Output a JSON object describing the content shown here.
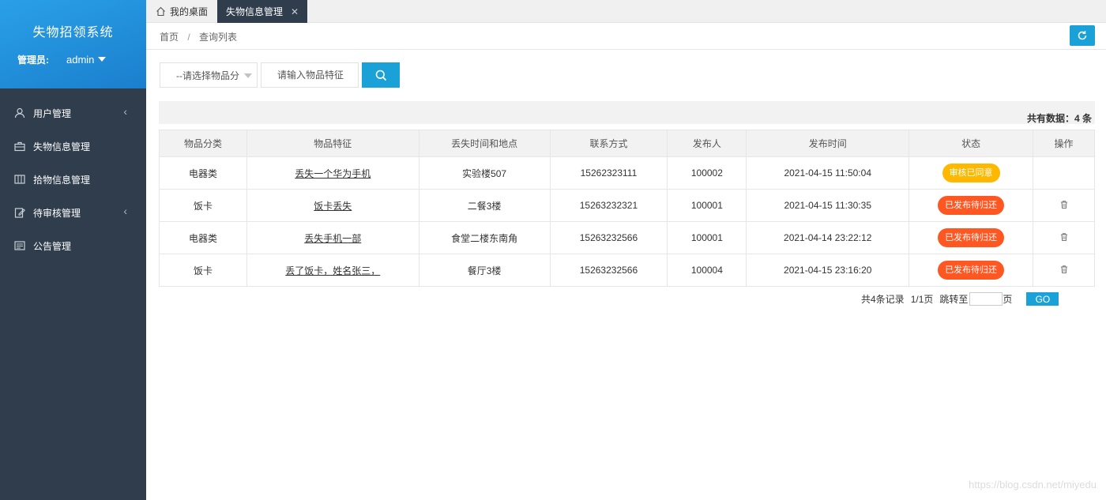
{
  "sidebar": {
    "title": "失物招领系统",
    "admin_label": "管理员:",
    "admin_name": "admin",
    "items": [
      {
        "label": "用户管理",
        "icon": "user-icon",
        "has_chevron": true
      },
      {
        "label": "失物信息管理",
        "icon": "briefcase-icon",
        "has_chevron": false
      },
      {
        "label": "拾物信息管理",
        "icon": "columns-icon",
        "has_chevron": false
      },
      {
        "label": "待审核管理",
        "icon": "edit-icon",
        "has_chevron": true
      },
      {
        "label": "公告管理",
        "icon": "notice-icon",
        "has_chevron": false
      }
    ]
  },
  "tabs": {
    "home_label": "我的桌面",
    "active_label": "失物信息管理",
    "close_glyph": "✕"
  },
  "breadcrumb": {
    "home": "首页",
    "separator": "/",
    "current": "查询列表"
  },
  "search": {
    "select_value": "--请选择物品分",
    "input_placeholder": "请输入物品特征"
  },
  "total": "共有数据：4 条",
  "table": {
    "headers": [
      "物品分类",
      "物品特征",
      "丢失时间和地点",
      "联系方式",
      "发布人",
      "发布时间",
      "状态",
      "操作"
    ],
    "rows": [
      {
        "category": "电器类",
        "feature": "丢失一个华为手机",
        "place": "实验楼507",
        "phone": "15262323111",
        "publisher": "100002",
        "time": "2021-04-15 11:50:04",
        "status": "审核已同意",
        "status_color": "#ffb800",
        "has_delete": false
      },
      {
        "category": "饭卡",
        "feature": "饭卡丢失",
        "place": "二餐3楼",
        "phone": "15263232321",
        "publisher": "100001",
        "time": "2021-04-15 11:30:35",
        "status": "已发布待归还",
        "status_color": "#ff5722",
        "has_delete": true
      },
      {
        "category": "电器类",
        "feature": "丢失手机一部",
        "place": "食堂二楼东南角",
        "phone": "15263232566",
        "publisher": "100001",
        "time": "2021-04-14 23:22:12",
        "status": "已发布待归还",
        "status_color": "#ff5722",
        "has_delete": true
      },
      {
        "category": "饭卡",
        "feature": "丢了饭卡，姓名张三，",
        "place": "餐厅3楼",
        "phone": "15263232566",
        "publisher": "100004",
        "time": "2021-04-15 23:16:20",
        "status": "已发布待归还",
        "status_color": "#ff5722",
        "has_delete": true
      }
    ]
  },
  "pager": {
    "records": "共4条记录",
    "pages": "1/1页",
    "jump_label": "跳转至",
    "page_suffix": "页",
    "go_label": "GO",
    "jump_value": ""
  },
  "watermark": "https://blog.csdn.net/miyedu",
  "colors": {
    "sidebar_bg": "#2f3d4c",
    "header_blue": "#1e8fd8",
    "accent": "#1aa1d8",
    "status_approved": "#ffb800",
    "status_pending": "#ff5722"
  }
}
